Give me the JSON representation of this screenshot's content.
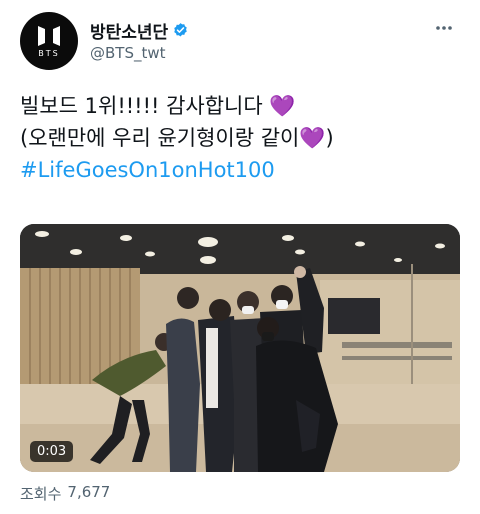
{
  "author": {
    "display_name": "방탄소년단",
    "handle": "@BTS_twt",
    "avatar_text": "BTS",
    "verified": true
  },
  "tweet": {
    "line1": "빌보드 1위!!!!! 감사합니다 ",
    "line1_emoji": "💜",
    "line2": "(오랜만에 우리 윤기형이랑 같이",
    "line2_emoji": "💜",
    "line2_end": ")",
    "hashtag": "#LifeGoesOn1onHot100"
  },
  "media": {
    "type": "video",
    "duration": "0:03"
  },
  "stats": {
    "views_label": "조회수",
    "views_count": "7,677"
  },
  "colors": {
    "link": "#1d9bf0",
    "verified": "#1d9bf0",
    "heart": "#9b4dea",
    "secondary_text": "#536471"
  },
  "icons": [
    "verified-badge-icon",
    "more-options-icon",
    "bts-logo-icon"
  ]
}
